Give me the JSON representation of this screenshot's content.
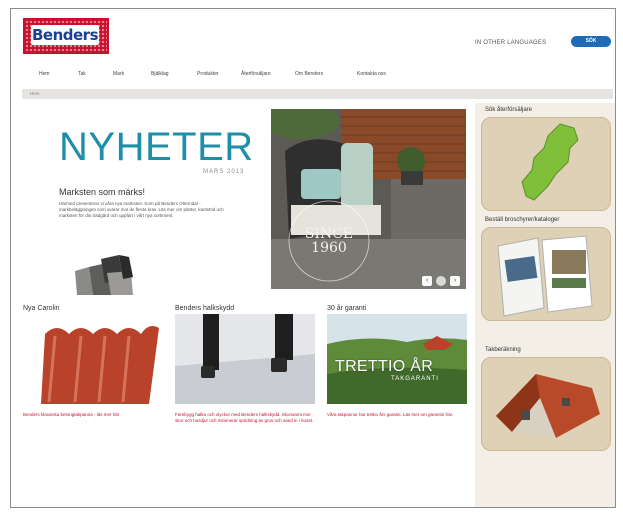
{
  "header": {
    "logo_text": "Benders",
    "other_languages": "IN OTHER LANGUAGES",
    "search_label": "SÖK"
  },
  "nav": {
    "items": [
      "Hem",
      "Tak",
      "Mark",
      "Bjälklag",
      "Produkter",
      "Återförsäljare",
      "Om Benders",
      "Kontakta oss"
    ]
  },
  "breadcrumb": "Hem",
  "hero": {
    "title": "NYHETER",
    "date": "MARS 2013",
    "subtitle": "Marksten som märks!",
    "body": "Härmed presenterar vi våra nya marksten. Kom på Benders Otterndal - markbeläggningen som svarar mot de flesta krav. Läs mer om plattor, kantstöd och marksten för din trädgård och uppfart i vårt nya sortiment.",
    "since_line1": "SINCE",
    "since_line2": "1960"
  },
  "columns": [
    {
      "title": "Nya Carolin",
      "text": "Benders klassiska betongtakpanna - läs mer här"
    },
    {
      "title": "Benders halkskydd",
      "text": "Förebygg halka och olyckor med Benders halkskydd. Skonsamt mot skor och husdjur och minimerar spridning av grus och sand in i huset."
    },
    {
      "title": "30 år garanti",
      "text": "Våra takpannor har trettio års garanti. Läs mer om garantin här.",
      "image_line1": "TRETTIO ÅR",
      "image_line2": "TAKGARANTI"
    }
  ],
  "sidebar": {
    "dealers_label": "Sök återförsäljare",
    "brochures_label": "Beställ broschyrer/kataloger",
    "roof_label": "Takberäkning"
  },
  "slider": {
    "prev": "‹",
    "next": "›"
  }
}
